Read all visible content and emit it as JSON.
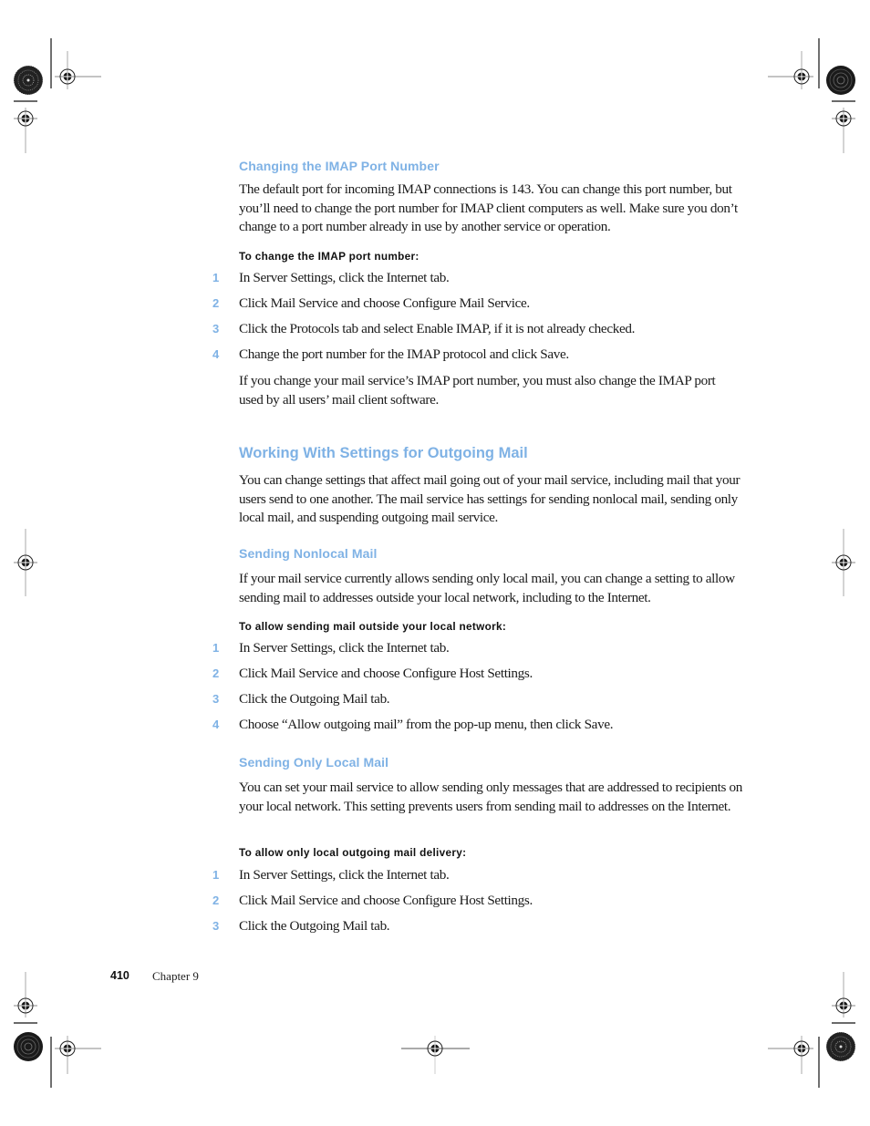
{
  "sections": {
    "imap_port": {
      "heading": "Changing the IMAP Port Number",
      "intro": "The default port for incoming IMAP connections is 143. You can change this port number, but you’ll need to change the port number for IMAP client computers as well. Make sure you don’t change to a port number already in use by another service or operation.",
      "task_title": "To change the IMAP port number:",
      "steps": [
        {
          "num": "1",
          "text": "In Server Settings, click the Internet tab."
        },
        {
          "num": "2",
          "text": "Click Mail Service and choose Configure Mail Service."
        },
        {
          "num": "3",
          "text": "Click the Protocols tab and select Enable IMAP, if it is not already checked."
        },
        {
          "num": "4",
          "text": "Change the port number for the IMAP protocol and click Save."
        }
      ],
      "note": "If you change your mail service’s IMAP port number, you must also change the IMAP port used by all users’ mail client software."
    },
    "outgoing": {
      "heading": "Working With Settings for Outgoing Mail",
      "intro": "You can change settings that affect mail going out of your mail service, including mail that your users send to one another. The mail service has settings for sending nonlocal mail, sending only local mail, and suspending outgoing mail service."
    },
    "nonlocal": {
      "heading": "Sending Nonlocal Mail",
      "intro": "If your mail service currently allows sending only local mail, you can change a setting to allow sending mail to addresses outside your local network, including to the Internet.",
      "task_title": "To allow sending mail outside your local network:",
      "steps": [
        {
          "num": "1",
          "text": "In Server Settings, click the Internet tab."
        },
        {
          "num": "2",
          "text": "Click Mail Service and choose Configure Host Settings."
        },
        {
          "num": "3",
          "text": "Click the Outgoing Mail tab."
        },
        {
          "num": "4",
          "text": "Choose “Allow outgoing mail” from the pop-up menu, then click Save."
        }
      ]
    },
    "local_only": {
      "heading": "Sending Only Local Mail",
      "intro": "You can set your mail service to allow sending only messages that are addressed to recipients on your local network. This setting prevents users from sending mail to addresses on the Internet.",
      "task_title": "To allow only local outgoing mail delivery:",
      "steps": [
        {
          "num": "1",
          "text": "In Server Settings, click the Internet tab."
        },
        {
          "num": "2",
          "text": "Click Mail Service and choose Configure Host Settings."
        },
        {
          "num": "3",
          "text": "Click the Outgoing Mail tab."
        }
      ]
    }
  },
  "footer": {
    "page_number": "410",
    "chapter": "Chapter  9"
  },
  "colors": {
    "heading_blue": "#7fb2e5",
    "body_text": "#1a1a1a"
  },
  "print_marks": {
    "registration_marks": "crosshair-target-icon",
    "color_bars": "starburst-target-icon"
  }
}
